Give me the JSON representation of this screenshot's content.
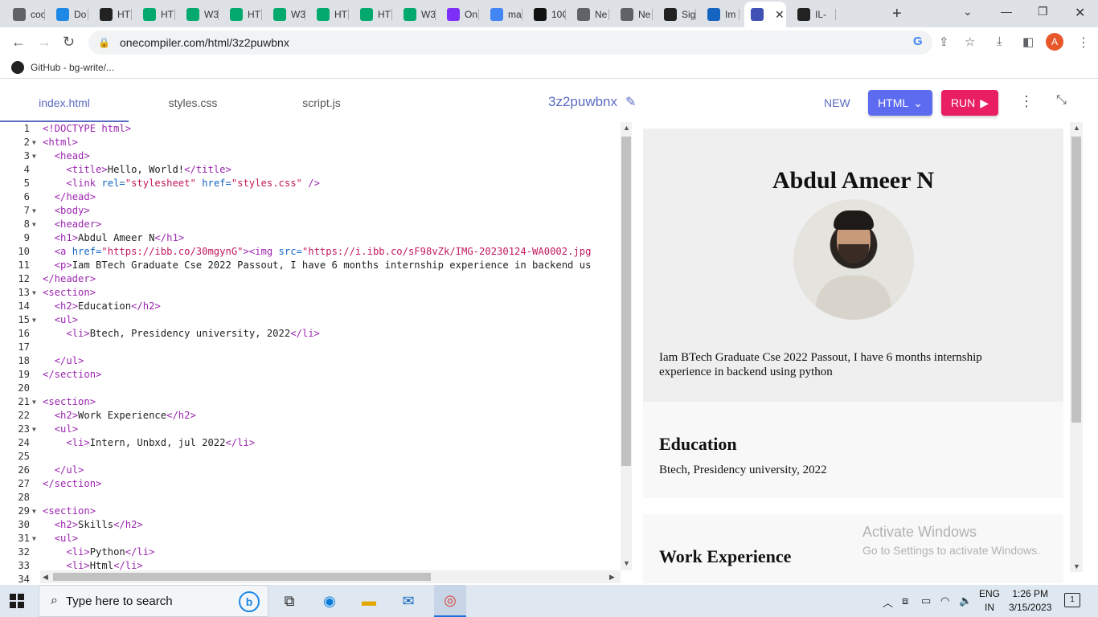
{
  "browser": {
    "tabs": [
      {
        "label": "coc",
        "color": "#5f6368"
      },
      {
        "label": "Do",
        "color": "#1e88e5"
      },
      {
        "label": "HT",
        "color": "#222222"
      },
      {
        "label": "HT",
        "color": "#04aa6d"
      },
      {
        "label": "W3",
        "color": "#04aa6d"
      },
      {
        "label": "HT",
        "color": "#04aa6d"
      },
      {
        "label": "W3",
        "color": "#04aa6d"
      },
      {
        "label": "HT",
        "color": "#04aa6d"
      },
      {
        "label": "HT",
        "color": "#04aa6d"
      },
      {
        "label": "W3",
        "color": "#04aa6d"
      },
      {
        "label": "On",
        "color": "#7b2ff7"
      },
      {
        "label": "ma",
        "color": "#4285f4"
      },
      {
        "label": "10C",
        "color": "#111111"
      },
      {
        "label": "Ne",
        "color": "#5f6368"
      },
      {
        "label": "Ne",
        "color": "#5f6368"
      },
      {
        "label": "Sig",
        "color": "#222222"
      },
      {
        "label": "Im",
        "color": "#1565c0"
      },
      {
        "label": "",
        "color": "#3f51b5"
      },
      {
        "label": "IL-",
        "color": "#222222"
      }
    ],
    "url": "onecompiler.com/html/3z2puwbnx",
    "avatar_letter": "A",
    "bookmark": "GitHub - bg-write/..."
  },
  "editor_header": {
    "file_tabs": [
      "index.html",
      "styles.css",
      "script.js"
    ],
    "title": "3z2puwbnx",
    "new_label": "NEW",
    "language_label": "HTML",
    "run_label": "RUN"
  },
  "code_lines": [
    {
      "n": "1",
      "fold": false,
      "html": "<span class='tg'>&lt;!DOCTYPE html&gt;</span>"
    },
    {
      "n": "2",
      "fold": true,
      "html": "<span class='tg'>&lt;html&gt;</span>"
    },
    {
      "n": "3",
      "fold": true,
      "html": "  <span class='tg'>&lt;head&gt;</span>"
    },
    {
      "n": "4",
      "fold": false,
      "html": "    <span class='tg'>&lt;title&gt;</span>Hello, World!<span class='tg'>&lt;/title&gt;</span>"
    },
    {
      "n": "5",
      "fold": false,
      "html": "    <span class='tg'>&lt;link </span><span class='at'>rel=</span><span class='st'>\"stylesheet\"</span> <span class='at'>href=</span><span class='st'>\"styles.css\"</span><span class='tg'> /&gt;</span>"
    },
    {
      "n": "6",
      "fold": false,
      "html": "  <span class='tg'>&lt;/head&gt;</span>"
    },
    {
      "n": "7",
      "fold": true,
      "html": "  <span class='tg'>&lt;body&gt;</span>"
    },
    {
      "n": "8",
      "fold": true,
      "html": "  <span class='tg'>&lt;header&gt;</span>"
    },
    {
      "n": "9",
      "fold": false,
      "html": "  <span class='tg'>&lt;h1&gt;</span>Abdul Ameer N<span class='tg'>&lt;/h1&gt;</span>"
    },
    {
      "n": "10",
      "fold": false,
      "html": "  <span class='tg'>&lt;a </span><span class='at'>href=</span><span class='st'>\"https://ibb.co/30mgynG\"</span><span class='tg'>&gt;&lt;img </span><span class='at'>src=</span><span class='st'>\"https://i.ibb.co/sF98vZk/IMG-20230124-WA0002.jpg</span>"
    },
    {
      "n": "11",
      "fold": false,
      "html": "  <span class='tg'>&lt;p&gt;</span>Iam BTech Graduate Cse 2022 Passout, I have 6 months internship experience in backend us"
    },
    {
      "n": "12",
      "fold": false,
      "html": "<span class='tg'>&lt;/header&gt;</span>"
    },
    {
      "n": "13",
      "fold": true,
      "html": "<span class='tg'>&lt;section&gt;</span>"
    },
    {
      "n": "14",
      "fold": false,
      "html": "  <span class='tg'>&lt;h2&gt;</span>Education<span class='tg'>&lt;/h2&gt;</span>"
    },
    {
      "n": "15",
      "fold": true,
      "html": "  <span class='tg'>&lt;ul&gt;</span>"
    },
    {
      "n": "16",
      "fold": false,
      "html": "    <span class='tg'>&lt;li&gt;</span>Btech, Presidency university, 2022<span class='tg'>&lt;/li&gt;</span>"
    },
    {
      "n": "17",
      "fold": false,
      "html": ""
    },
    {
      "n": "18",
      "fold": false,
      "html": "  <span class='tg'>&lt;/ul&gt;</span>"
    },
    {
      "n": "19",
      "fold": false,
      "html": "<span class='tg'>&lt;/section&gt;</span>"
    },
    {
      "n": "20",
      "fold": false,
      "html": ""
    },
    {
      "n": "21",
      "fold": true,
      "html": "<span class='tg'>&lt;section&gt;</span>"
    },
    {
      "n": "22",
      "fold": false,
      "html": "  <span class='tg'>&lt;h2&gt;</span>Work Experience<span class='tg'>&lt;/h2&gt;</span>"
    },
    {
      "n": "23",
      "fold": true,
      "html": "  <span class='tg'>&lt;ul&gt;</span>"
    },
    {
      "n": "24",
      "fold": false,
      "html": "    <span class='tg'>&lt;li&gt;</span>Intern, Unbxd, jul 2022<span class='tg'>&lt;/li&gt;</span>"
    },
    {
      "n": "25",
      "fold": false,
      "html": ""
    },
    {
      "n": "26",
      "fold": false,
      "html": "  <span class='tg'>&lt;/ul&gt;</span>"
    },
    {
      "n": "27",
      "fold": false,
      "html": "<span class='tg'>&lt;/section&gt;</span>"
    },
    {
      "n": "28",
      "fold": false,
      "html": ""
    },
    {
      "n": "29",
      "fold": true,
      "html": "<span class='tg'>&lt;section&gt;</span>"
    },
    {
      "n": "30",
      "fold": false,
      "html": "  <span class='tg'>&lt;h2&gt;</span>Skills<span class='tg'>&lt;/h2&gt;</span>"
    },
    {
      "n": "31",
      "fold": true,
      "html": "  <span class='tg'>&lt;ul&gt;</span>"
    },
    {
      "n": "32",
      "fold": false,
      "html": "    <span class='tg'>&lt;li&gt;</span>Python<span class='tg'>&lt;/li&gt;</span>"
    },
    {
      "n": "33",
      "fold": false,
      "html": "    <span class='tg'>&lt;li&gt;</span>Html<span class='tg'>&lt;/li&gt;</span>"
    },
    {
      "n": "34",
      "fold": false,
      "html": ""
    }
  ],
  "preview": {
    "name": "Abdul Ameer N",
    "intro": "Iam BTech Graduate Cse 2022 Passout, I have 6 months internship experience in backend using python",
    "education_heading": "Education",
    "education_item": "Btech, Presidency university, 2022",
    "work_heading": "Work Experience"
  },
  "watermark": {
    "line1": "Activate Windows",
    "line2": "Go to Settings to activate Windows."
  },
  "taskbar": {
    "search_placeholder": "Type here to search",
    "lang_line1": "ENG",
    "lang_line2": "IN",
    "time": "1:26 PM",
    "date": "3/15/2023",
    "notification_count": "1"
  }
}
